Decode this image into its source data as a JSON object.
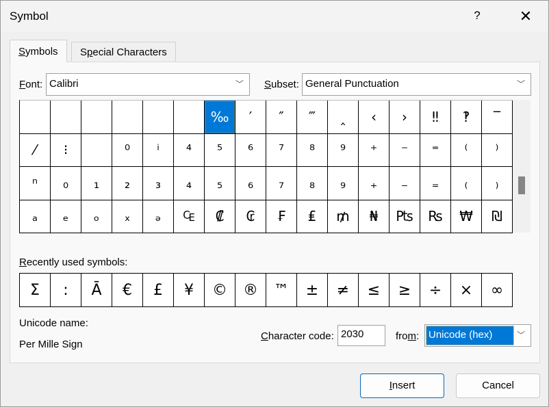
{
  "window": {
    "title": "Symbol",
    "help": "?",
    "close": "✕"
  },
  "tabs": [
    {
      "label_u": "S",
      "label_rest": "ymbols",
      "active": true
    },
    {
      "label_pre": "S",
      "label_u": "p",
      "label_rest": "ecial Characters",
      "active": false
    }
  ],
  "font": {
    "label_u": "F",
    "label_rest": "ont:",
    "value": "Calibri"
  },
  "subset": {
    "label_u": "S",
    "label_rest": "ubset:",
    "value": "General Punctuation"
  },
  "symbols": [
    "",
    "",
    "",
    "",
    "",
    "",
    "‰",
    "′",
    "″",
    "‴",
    "‸",
    "‹",
    "›",
    "‼",
    "‽",
    "‾",
    "⁄",
    "⁝",
    "",
    "⁰",
    "ⁱ",
    "⁴",
    "⁵",
    "⁶",
    "⁷",
    "⁸",
    "⁹",
    "⁺",
    "⁻",
    "⁼",
    "⁽",
    "⁾",
    "ⁿ",
    "₀",
    "₁",
    "₂",
    "₃",
    "₄",
    "₅",
    "₆",
    "₇",
    "₈",
    "₉",
    "₊",
    "₋",
    "₌",
    "₍",
    "₎",
    "ₐ",
    "ₑ",
    "ₒ",
    "ₓ",
    "ₔ",
    "₠",
    "₡",
    "₢",
    "₣",
    "₤",
    "₥",
    "₦",
    "₧",
    "₨",
    "₩",
    "₪"
  ],
  "selected_symbol": "‰",
  "recent": {
    "label_u": "R",
    "label_rest": "ecently used symbols:",
    "items": [
      "Σ",
      ":",
      "Ā",
      "€",
      "£",
      "¥",
      "©",
      "®",
      "™",
      "±",
      "≠",
      "≤",
      "≥",
      "÷",
      "×",
      "∞"
    ]
  },
  "unicode_name": {
    "label": "Unicode name:",
    "value": "Per Mille Sign"
  },
  "char_code": {
    "label_u": "C",
    "label_rest": "haracter code:",
    "value": "2030"
  },
  "from": {
    "label_pre": "fro",
    "label_u": "m",
    "label_rest": ":",
    "value": "Unicode (hex)"
  },
  "buttons": {
    "insert_u": "I",
    "insert_rest": "nsert",
    "cancel": "Cancel"
  },
  "colors": {
    "accent": "#0078d7"
  }
}
